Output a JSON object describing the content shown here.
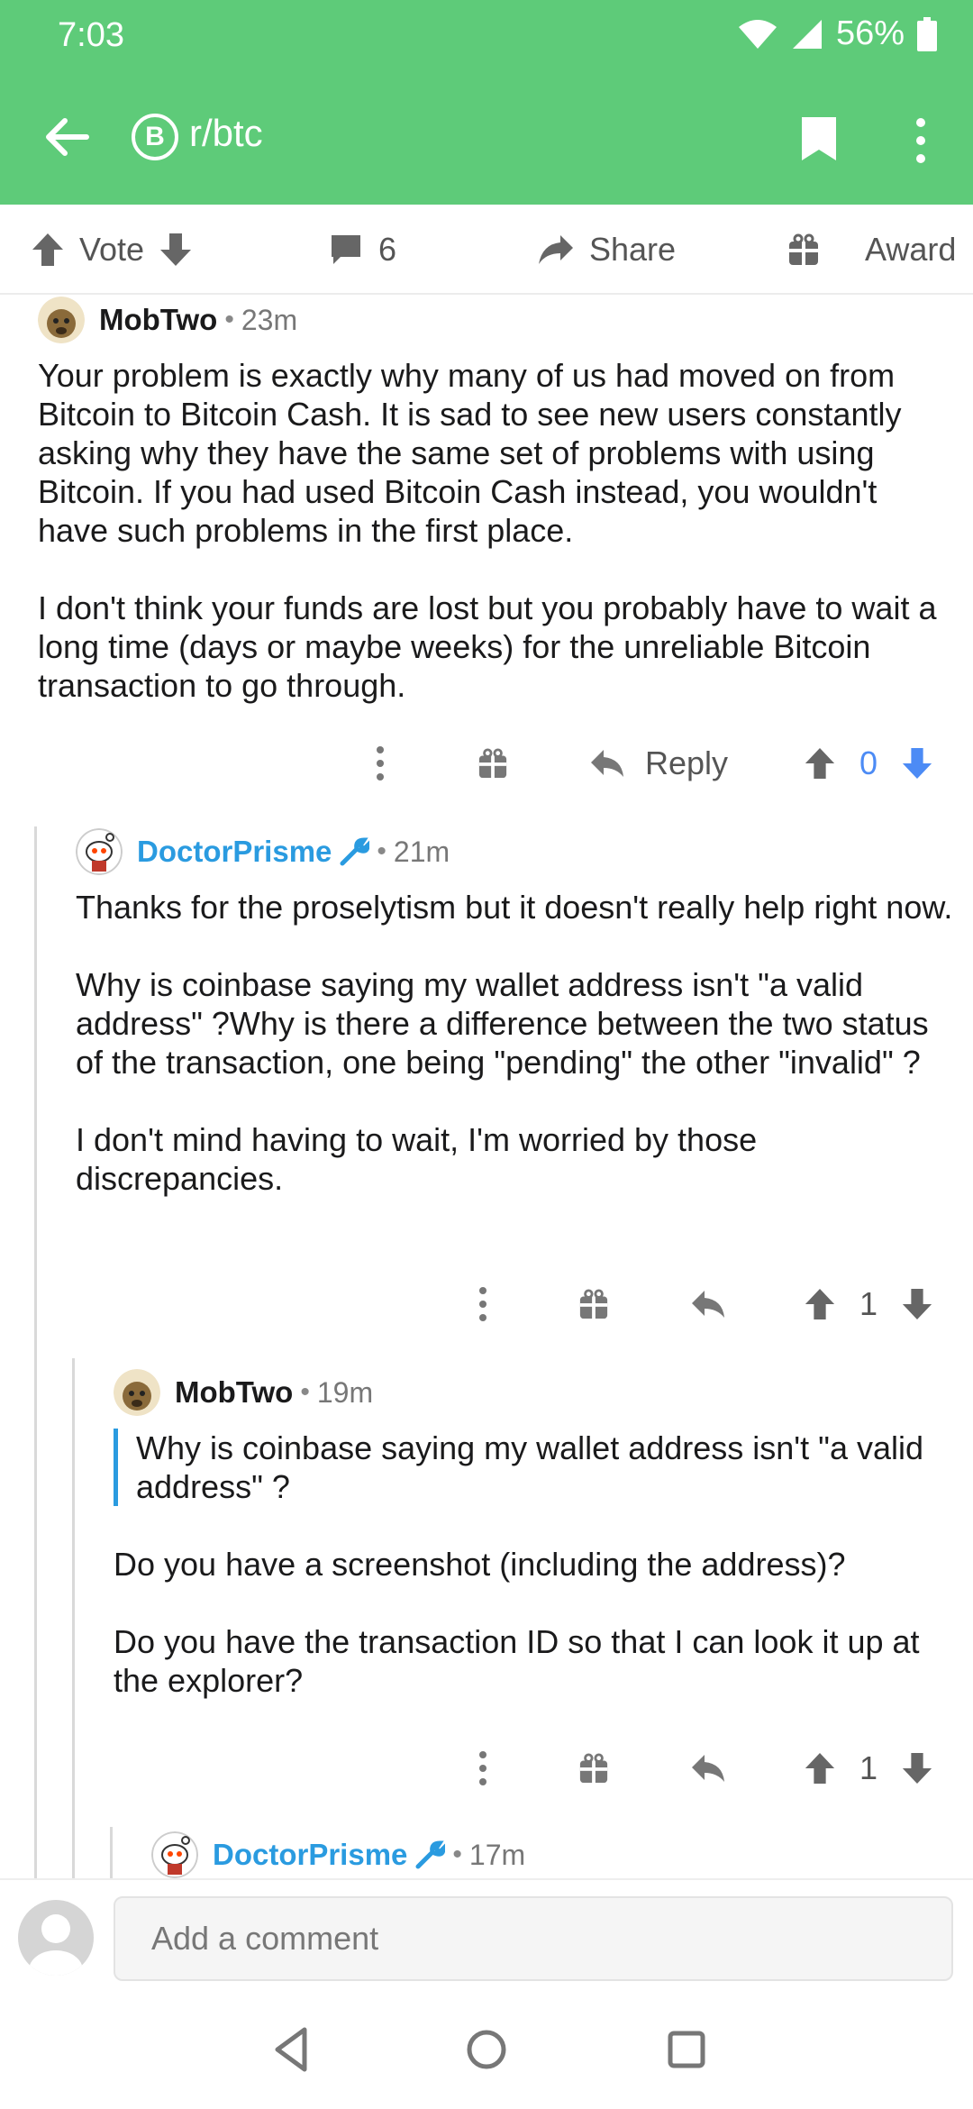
{
  "status": {
    "time": "7:03",
    "battery": "56%"
  },
  "header": {
    "subreddit": "r/btc",
    "sub_icon_glyph": "B"
  },
  "post_actions": {
    "vote": "Vote",
    "comments": "6",
    "share": "Share",
    "award": "Award"
  },
  "comments": [
    {
      "author": "MobTwo",
      "age": "23m",
      "paragraphs": [
        "Your problem is exactly why many of us had moved on from Bitcoin to Bitcoin Cash. It is sad to see new users constantly asking why they have the same set of problems with using Bitcoin. If you had used Bitcoin Cash instead, you wouldn't have such problems in the first place.",
        "I don't think your funds are lost but you probably have to wait a long time (days or maybe weeks) for the unreliable Bitcoin transaction to go through."
      ],
      "reply": "Reply",
      "score": "0"
    },
    {
      "author": "DoctorPrisme",
      "age": "21m",
      "paragraphs": [
        "Thanks for the proselytism but it doesn't really help right now.",
        "Why is coinbase saying my wallet address isn't \"a valid address\" ?Why is there a difference between the two status of the transaction, one being \"pending\" the other \"invalid\" ?",
        "I don't mind having to wait, I'm worried by those discrepancies."
      ],
      "score": "1"
    },
    {
      "author": "MobTwo",
      "age": "19m",
      "quote": "Why is coinbase saying my wallet address isn't \"a valid address\" ?",
      "paragraphs": [
        "Do you have a screenshot (including the address)?",
        "Do you have the transaction ID so that I can look it up at the explorer?"
      ],
      "score": "1"
    },
    {
      "author": "DoctorPrisme",
      "age": "17m"
    }
  ],
  "composer": {
    "placeholder": "Add a comment"
  },
  "colors": {
    "header": "#5ecb79",
    "op_author": "#2a9be0",
    "downvote_active": "#4c8bf5"
  }
}
